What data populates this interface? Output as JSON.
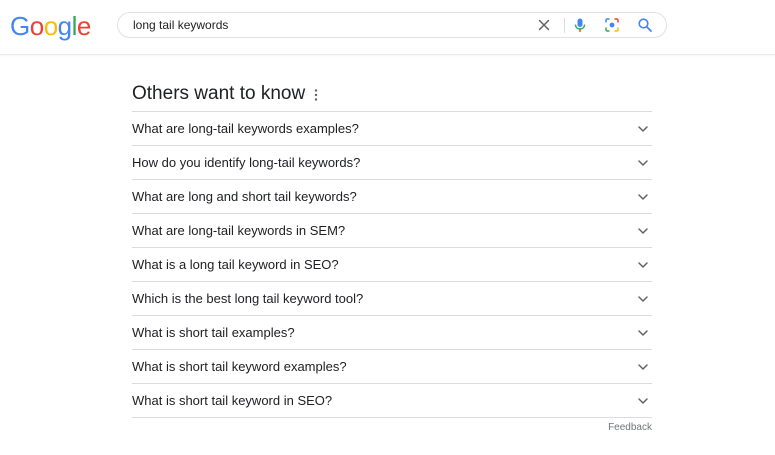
{
  "header": {
    "logo": {
      "letters": [
        "G",
        "o",
        "o",
        "g",
        "l",
        "e"
      ],
      "colors": [
        "#4285F4",
        "#EA4335",
        "#FBBC05",
        "#4285F4",
        "#34A853",
        "#EA4335"
      ]
    },
    "search": {
      "value": "long tail keywords",
      "icons": [
        "close-icon",
        "microphone-icon",
        "camera-lens-icon",
        "search-icon"
      ]
    }
  },
  "paa": {
    "title": "Others want to know",
    "menu_icon": "more-vertical-icon",
    "questions": [
      "What are long-tail keywords examples?",
      "How do you identify long-tail keywords?",
      "What are long and short tail keywords?",
      "What are long-tail keywords in SEM?",
      "What is a long tail keyword in SEO?",
      "Which is the best long tail keyword tool?",
      "What is short tail examples?",
      "What is short tail keyword examples?",
      "What is short tail keyword in SEO?"
    ],
    "feedback": "Feedback"
  },
  "colors": {
    "text": "#202124",
    "muted": "#70757a",
    "divider": "#dadce0",
    "blue": "#4285F4",
    "red": "#EA4335",
    "yellow": "#FBBC05",
    "green": "#34A853"
  }
}
